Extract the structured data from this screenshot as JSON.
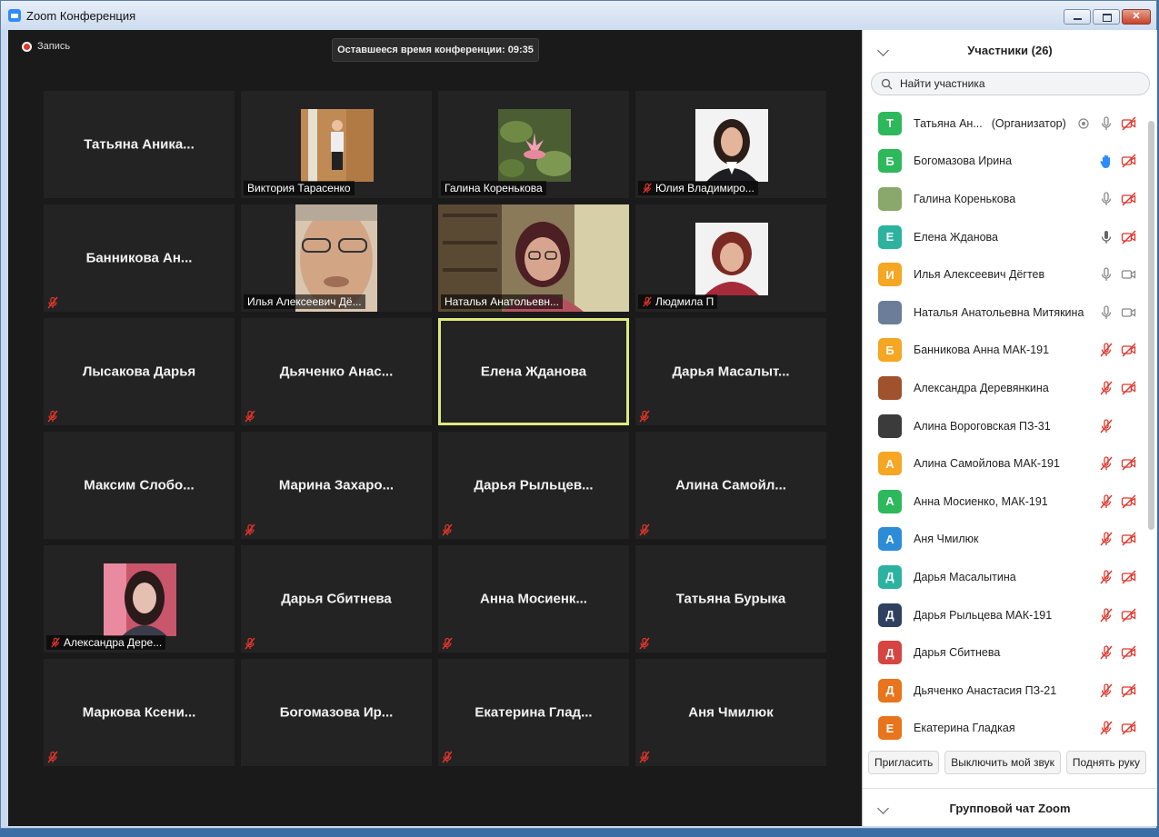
{
  "window": {
    "title": "Zoom Конференция"
  },
  "meeting": {
    "recording_label": "Запись",
    "remaining_time": "Оставшееся время конференции: 09:35"
  },
  "tiles": [
    {
      "name": "Татьяна  Аника...",
      "label": "",
      "muted": false,
      "video": null,
      "active": false
    },
    {
      "name": "",
      "label": "Виктория Тарасенко",
      "muted": false,
      "video": "woman-standing",
      "active": false
    },
    {
      "name": "",
      "label": "Галина Коренькова",
      "muted": false,
      "video": "lotus",
      "active": false
    },
    {
      "name": "",
      "label": "Юлия Владимиро...",
      "muted": true,
      "video": "portrait-dark-hair",
      "active": false
    },
    {
      "name": "Банникова  Ан...",
      "label": "",
      "muted": true,
      "video": null,
      "active": false
    },
    {
      "name": "",
      "label": "Илья Алексеевич Дё...",
      "muted": false,
      "video": "elderly-man",
      "active": false
    },
    {
      "name": "",
      "label": "Наталья Анатольевн...",
      "muted": false,
      "video": "woman-bookshelf",
      "active": false
    },
    {
      "name": "",
      "label": "Людмила П",
      "muted": true,
      "video": "portrait-red-hair",
      "active": false
    },
    {
      "name": "Лысакова Дарья",
      "label": "",
      "muted": true,
      "video": null,
      "active": false
    },
    {
      "name": "Дьяченко  Анас...",
      "label": "",
      "muted": true,
      "video": null,
      "active": false
    },
    {
      "name": "Елена Жданова",
      "label": "",
      "muted": false,
      "video": null,
      "active": true
    },
    {
      "name": "Дарья  Масалыт...",
      "label": "",
      "muted": true,
      "video": null,
      "active": false
    },
    {
      "name": "Максим  Слобо...",
      "label": "",
      "muted": false,
      "video": null,
      "active": false
    },
    {
      "name": "Марина  Захаро...",
      "label": "",
      "muted": true,
      "video": null,
      "active": false
    },
    {
      "name": "Дарья  Рыльцев...",
      "label": "",
      "muted": true,
      "video": null,
      "active": false
    },
    {
      "name": "Алина  Самойл...",
      "label": "",
      "muted": true,
      "video": null,
      "active": false
    },
    {
      "name": "",
      "label": "Александра Дере...",
      "muted": true,
      "video": "girl-photo",
      "active": false
    },
    {
      "name": "Дарья Сбитнева",
      "label": "",
      "muted": true,
      "video": null,
      "active": false
    },
    {
      "name": "Анна  Мосиенк...",
      "label": "",
      "muted": true,
      "video": null,
      "active": false
    },
    {
      "name": "Татьяна Бурыка",
      "label": "",
      "muted": true,
      "video": null,
      "active": false
    },
    {
      "name": "Маркова  Ксени...",
      "label": "",
      "muted": true,
      "video": null,
      "active": false
    },
    {
      "name": "Богомазова  Ир...",
      "label": "",
      "muted": false,
      "video": null,
      "active": false
    },
    {
      "name": "Екатерина  Глад...",
      "label": "",
      "muted": true,
      "video": null,
      "active": false
    },
    {
      "name": "Аня Чмилюк",
      "label": "",
      "muted": true,
      "video": null,
      "active": false
    }
  ],
  "participants_panel": {
    "title": "Участники (26)",
    "search_placeholder": "Найти участника",
    "participants": [
      {
        "initial": "Т",
        "color": "#2eb85c",
        "name": "Татьяна Ан...",
        "role": "(Организатор)",
        "mic": "on",
        "cam": "off",
        "extra": "record-icon"
      },
      {
        "initial": "Б",
        "color": "#2eb85c",
        "name": "Богомазова Ирина",
        "role": "",
        "mic": "hand",
        "cam": "off",
        "extra": ""
      },
      {
        "initial": "",
        "color": "#8aa86b",
        "name": "Галина Коренькова",
        "role": "",
        "mic": "on",
        "cam": "off",
        "extra": ""
      },
      {
        "initial": "Е",
        "color": "#2cb3a0",
        "name": "Елена Жданова",
        "role": "",
        "mic": "speaking",
        "cam": "off",
        "extra": ""
      },
      {
        "initial": "И",
        "color": "#f5a623",
        "name": "Илья Алексеевич Дёгтев",
        "role": "",
        "mic": "on",
        "cam": "on",
        "extra": ""
      },
      {
        "initial": "",
        "color": "#6b7d99",
        "name": "Наталья Анатольевна Митякина",
        "role": "",
        "mic": "on",
        "cam": "on",
        "extra": ""
      },
      {
        "initial": "Б",
        "color": "#f5a623",
        "name": " Банникова Анна МАК-191",
        "role": "",
        "mic": "off",
        "cam": "off",
        "extra": ""
      },
      {
        "initial": "",
        "color": "#a0522d",
        "name": "Александра Деревянкина",
        "role": "",
        "mic": "off",
        "cam": "off",
        "extra": ""
      },
      {
        "initial": "",
        "color": "#3b3b3b",
        "name": "Алина Вороговская ПЗ-31",
        "role": "",
        "mic": "off",
        "cam": "",
        "extra": ""
      },
      {
        "initial": "А",
        "color": "#f5a623",
        "name": "Алина Самойлова МАК-191",
        "role": "",
        "mic": "off",
        "cam": "off",
        "extra": ""
      },
      {
        "initial": "А",
        "color": "#2eb85c",
        "name": "Анна Мосиенко, МАК-191",
        "role": "",
        "mic": "off",
        "cam": "off",
        "extra": ""
      },
      {
        "initial": "А",
        "color": "#2d8cd6",
        "name": "Аня Чмилюк",
        "role": "",
        "mic": "off",
        "cam": "off",
        "extra": ""
      },
      {
        "initial": "Д",
        "color": "#2cb3a0",
        "name": "Дарья Масалытина",
        "role": "",
        "mic": "off",
        "cam": "off",
        "extra": ""
      },
      {
        "initial": "Д",
        "color": "#2f4060",
        "name": "Дарья Рыльцева МАК-191",
        "role": "",
        "mic": "off",
        "cam": "off",
        "extra": ""
      },
      {
        "initial": "Д",
        "color": "#d64541",
        "name": "Дарья Сбитнева",
        "role": "",
        "mic": "off",
        "cam": "off",
        "extra": ""
      },
      {
        "initial": "Д",
        "color": "#e8741c",
        "name": "Дьяченко Анастасия ПЗ-21",
        "role": "",
        "mic": "off",
        "cam": "off",
        "extra": ""
      },
      {
        "initial": "Е",
        "color": "#e8741c",
        "name": "Екатерина Гладкая",
        "role": "",
        "mic": "off",
        "cam": "off",
        "extra": ""
      }
    ],
    "buttons": {
      "invite": "Пригласить",
      "mute_me": "Выключить мой звук",
      "raise_hand": "Поднять руку"
    }
  },
  "chat_panel": {
    "title": "Групповой чат Zoom"
  },
  "colors": {
    "active_speaker_border": "#dfe77f",
    "muted_red": "#e0352b",
    "zoom_blue": "#2d8cff"
  }
}
